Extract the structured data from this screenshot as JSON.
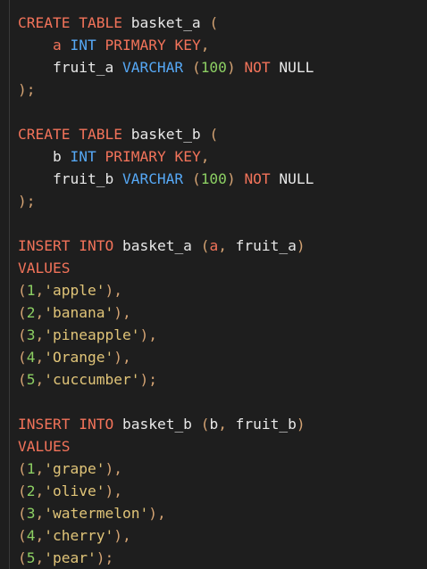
{
  "editor": {
    "language": "sql",
    "colors": {
      "background": "#1e1e1e",
      "keyword": "#f2735a",
      "type": "#56a8f5",
      "identifier": "#e8e8e8",
      "punctuation": "#d4a373",
      "number": "#8ccf63",
      "string": "#e0c478"
    },
    "lines": [
      [
        {
          "t": "k",
          "v": "CREATE"
        },
        {
          "t": "p",
          "v": " "
        },
        {
          "t": "k",
          "v": "TABLE"
        },
        {
          "t": "p",
          "v": " basket_a "
        },
        {
          "t": "u",
          "v": "("
        }
      ],
      [
        {
          "t": "p",
          "v": "    "
        },
        {
          "t": "k",
          "v": "a"
        },
        {
          "t": "p",
          "v": " "
        },
        {
          "t": "y",
          "v": "INT"
        },
        {
          "t": "p",
          "v": " "
        },
        {
          "t": "k",
          "v": "PRIMARY"
        },
        {
          "t": "p",
          "v": " "
        },
        {
          "t": "k",
          "v": "KEY"
        },
        {
          "t": "u",
          "v": ","
        }
      ],
      [
        {
          "t": "p",
          "v": "    fruit_a "
        },
        {
          "t": "y",
          "v": "VARCHAR"
        },
        {
          "t": "p",
          "v": " "
        },
        {
          "t": "u",
          "v": "("
        },
        {
          "t": "n",
          "v": "100"
        },
        {
          "t": "u",
          "v": ")"
        },
        {
          "t": "p",
          "v": " "
        },
        {
          "t": "k",
          "v": "NOT"
        },
        {
          "t": "p",
          "v": " NULL"
        }
      ],
      [
        {
          "t": "u",
          "v": ");"
        }
      ],
      [],
      [
        {
          "t": "k",
          "v": "CREATE"
        },
        {
          "t": "p",
          "v": " "
        },
        {
          "t": "k",
          "v": "TABLE"
        },
        {
          "t": "p",
          "v": " basket_b "
        },
        {
          "t": "u",
          "v": "("
        }
      ],
      [
        {
          "t": "p",
          "v": "    b "
        },
        {
          "t": "y",
          "v": "INT"
        },
        {
          "t": "p",
          "v": " "
        },
        {
          "t": "k",
          "v": "PRIMARY"
        },
        {
          "t": "p",
          "v": " "
        },
        {
          "t": "k",
          "v": "KEY"
        },
        {
          "t": "u",
          "v": ","
        }
      ],
      [
        {
          "t": "p",
          "v": "    fruit_b "
        },
        {
          "t": "y",
          "v": "VARCHAR"
        },
        {
          "t": "p",
          "v": " "
        },
        {
          "t": "u",
          "v": "("
        },
        {
          "t": "n",
          "v": "100"
        },
        {
          "t": "u",
          "v": ")"
        },
        {
          "t": "p",
          "v": " "
        },
        {
          "t": "k",
          "v": "NOT"
        },
        {
          "t": "p",
          "v": " NULL"
        }
      ],
      [
        {
          "t": "u",
          "v": ");"
        }
      ],
      [],
      [
        {
          "t": "k",
          "v": "INSERT"
        },
        {
          "t": "p",
          "v": " "
        },
        {
          "t": "k",
          "v": "INTO"
        },
        {
          "t": "p",
          "v": " basket_a "
        },
        {
          "t": "u",
          "v": "("
        },
        {
          "t": "k",
          "v": "a"
        },
        {
          "t": "u",
          "v": ","
        },
        {
          "t": "p",
          "v": " fruit_a"
        },
        {
          "t": "u",
          "v": ")"
        }
      ],
      [
        {
          "t": "k",
          "v": "VALUES"
        }
      ],
      [
        {
          "t": "u",
          "v": "("
        },
        {
          "t": "n",
          "v": "1"
        },
        {
          "t": "u",
          "v": ","
        },
        {
          "t": "s",
          "v": "'apple'"
        },
        {
          "t": "u",
          "v": "),"
        }
      ],
      [
        {
          "t": "u",
          "v": "("
        },
        {
          "t": "n",
          "v": "2"
        },
        {
          "t": "u",
          "v": ","
        },
        {
          "t": "s",
          "v": "'banana'"
        },
        {
          "t": "u",
          "v": "),"
        }
      ],
      [
        {
          "t": "u",
          "v": "("
        },
        {
          "t": "n",
          "v": "3"
        },
        {
          "t": "u",
          "v": ","
        },
        {
          "t": "s",
          "v": "'pineapple'"
        },
        {
          "t": "u",
          "v": "),"
        }
      ],
      [
        {
          "t": "u",
          "v": "("
        },
        {
          "t": "n",
          "v": "4"
        },
        {
          "t": "u",
          "v": ","
        },
        {
          "t": "s",
          "v": "'Orange'"
        },
        {
          "t": "u",
          "v": "),"
        }
      ],
      [
        {
          "t": "u",
          "v": "("
        },
        {
          "t": "n",
          "v": "5"
        },
        {
          "t": "u",
          "v": ","
        },
        {
          "t": "s",
          "v": "'cuccumber'"
        },
        {
          "t": "u",
          "v": ");"
        }
      ],
      [],
      [
        {
          "t": "k",
          "v": "INSERT"
        },
        {
          "t": "p",
          "v": " "
        },
        {
          "t": "k",
          "v": "INTO"
        },
        {
          "t": "p",
          "v": " basket_b "
        },
        {
          "t": "u",
          "v": "("
        },
        {
          "t": "p",
          "v": "b"
        },
        {
          "t": "u",
          "v": ","
        },
        {
          "t": "p",
          "v": " fruit_b"
        },
        {
          "t": "u",
          "v": ")"
        }
      ],
      [
        {
          "t": "k",
          "v": "VALUES"
        }
      ],
      [
        {
          "t": "u",
          "v": "("
        },
        {
          "t": "n",
          "v": "1"
        },
        {
          "t": "u",
          "v": ","
        },
        {
          "t": "s",
          "v": "'grape'"
        },
        {
          "t": "u",
          "v": "),"
        }
      ],
      [
        {
          "t": "u",
          "v": "("
        },
        {
          "t": "n",
          "v": "2"
        },
        {
          "t": "u",
          "v": ","
        },
        {
          "t": "s",
          "v": "'olive'"
        },
        {
          "t": "u",
          "v": "),"
        }
      ],
      [
        {
          "t": "u",
          "v": "("
        },
        {
          "t": "n",
          "v": "3"
        },
        {
          "t": "u",
          "v": ","
        },
        {
          "t": "s",
          "v": "'watermelon'"
        },
        {
          "t": "u",
          "v": "),"
        }
      ],
      [
        {
          "t": "u",
          "v": "("
        },
        {
          "t": "n",
          "v": "4"
        },
        {
          "t": "u",
          "v": ","
        },
        {
          "t": "s",
          "v": "'cherry'"
        },
        {
          "t": "u",
          "v": "),"
        }
      ],
      [
        {
          "t": "u",
          "v": "("
        },
        {
          "t": "n",
          "v": "5"
        },
        {
          "t": "u",
          "v": ","
        },
        {
          "t": "s",
          "v": "'pear'"
        },
        {
          "t": "u",
          "v": ");"
        }
      ]
    ]
  }
}
